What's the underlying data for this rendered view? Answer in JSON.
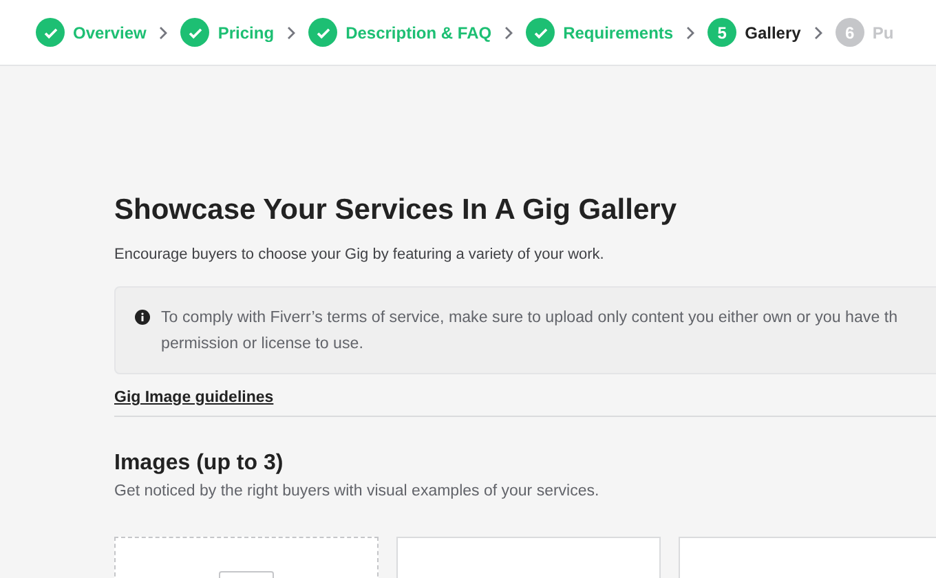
{
  "steps": [
    {
      "label": "Overview",
      "done": true,
      "selected": false
    },
    {
      "label": "Pricing",
      "done": true,
      "selected": false
    },
    {
      "label": "Description & FAQ",
      "done": true,
      "selected": false
    },
    {
      "label": "Requirements",
      "done": true,
      "selected": false
    },
    {
      "number": "5",
      "label": "Gallery",
      "done": false,
      "selected": true
    },
    {
      "number": "6",
      "label": "Pu",
      "done": false,
      "selected": false
    }
  ],
  "title": "Showcase Your Services In A Gig Gallery",
  "subtitle": "Encourage buyers to choose your Gig by featuring a variety of your work.",
  "notice": {
    "lines": [
      "To comply with Fiverr’s terms of service, make sure to upload only content you either own or you have th",
      "permission or license to use."
    ]
  },
  "guidelines_link": "Gig Image guidelines",
  "images": {
    "heading": "Images (up to 3)",
    "description": "Get noticed by the right buyers with visual examples of your services.",
    "slots": [
      {
        "kind": "upload"
      },
      {
        "kind": "empty"
      },
      {
        "kind": "empty"
      }
    ]
  }
}
